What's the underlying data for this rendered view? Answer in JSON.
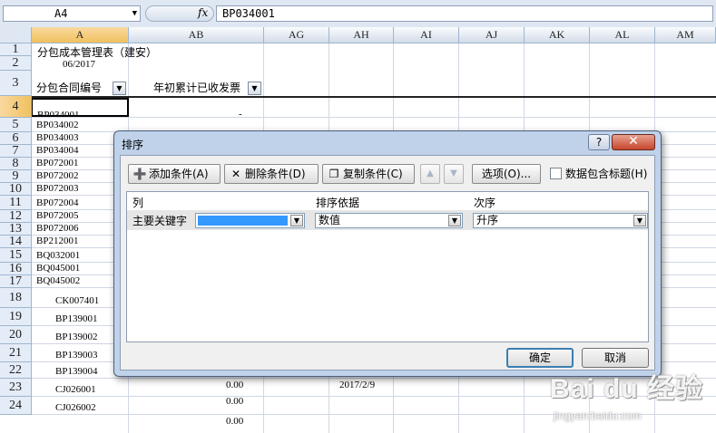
{
  "formula_bar": {
    "name_box": "A4",
    "fx_label": "fx",
    "formula": "BP034001"
  },
  "columns": [
    "A",
    "AB",
    "AG",
    "AH",
    "AI",
    "AJ",
    "AK",
    "AL",
    "AM"
  ],
  "rows": [
    "1",
    "2",
    "3",
    "4",
    "5",
    "6",
    "7",
    "8",
    "9",
    "10",
    "11",
    "12",
    "13",
    "14",
    "15",
    "16",
    "17",
    "18",
    "19",
    "20",
    "21",
    "22",
    "23",
    "24"
  ],
  "sheet": {
    "title": "分包成本管理表（建安）",
    "period": "06/2017",
    "header_a": "分包合同编号",
    "header_ab": "年初累计已收发票",
    "a4_value": "BP034001",
    "ab4_value": "-",
    "codes": [
      "BP034001",
      "BP034002",
      "BP034003",
      "BP034004",
      "BP072001",
      "BP072002",
      "BP072003",
      "BP072004",
      "BP072005",
      "BP072006",
      "BP212001",
      "BQ032001",
      "BQ045001",
      "BQ045002",
      "CK007401",
      "BP139001",
      "BP139002",
      "BP139003",
      "BP139004",
      "CJ026001",
      "CJ026002"
    ],
    "ab_values": {
      "22": "0.00",
      "23": "0.00",
      "24": "0.00"
    },
    "ah22": "2017/2/9"
  },
  "dialog": {
    "title": "排序",
    "help": "?",
    "close": "✕",
    "add_level": "添加条件(A)",
    "delete_level": "删除条件(D)",
    "copy_level": "复制条件(C)",
    "options": "选项(O)...",
    "has_headers": "数据包含标题(H)",
    "col_header": "列",
    "sort_on_header": "排序依据",
    "order_header": "次序",
    "row_label": "主要关键字",
    "column_value": "",
    "sort_on_value": "数值",
    "order_value": "升序",
    "ok": "确定",
    "cancel": "取消"
  },
  "watermark": {
    "logo": "Bai du 经验",
    "url": "jingyan.baidu.com"
  },
  "colors": {
    "selection_header": "#f1c15f",
    "header_bg": "#dfe7f2",
    "dialog_frame": "#bfd2ea",
    "focus_fill": "#3399ff",
    "close_red": "#c6452c"
  }
}
